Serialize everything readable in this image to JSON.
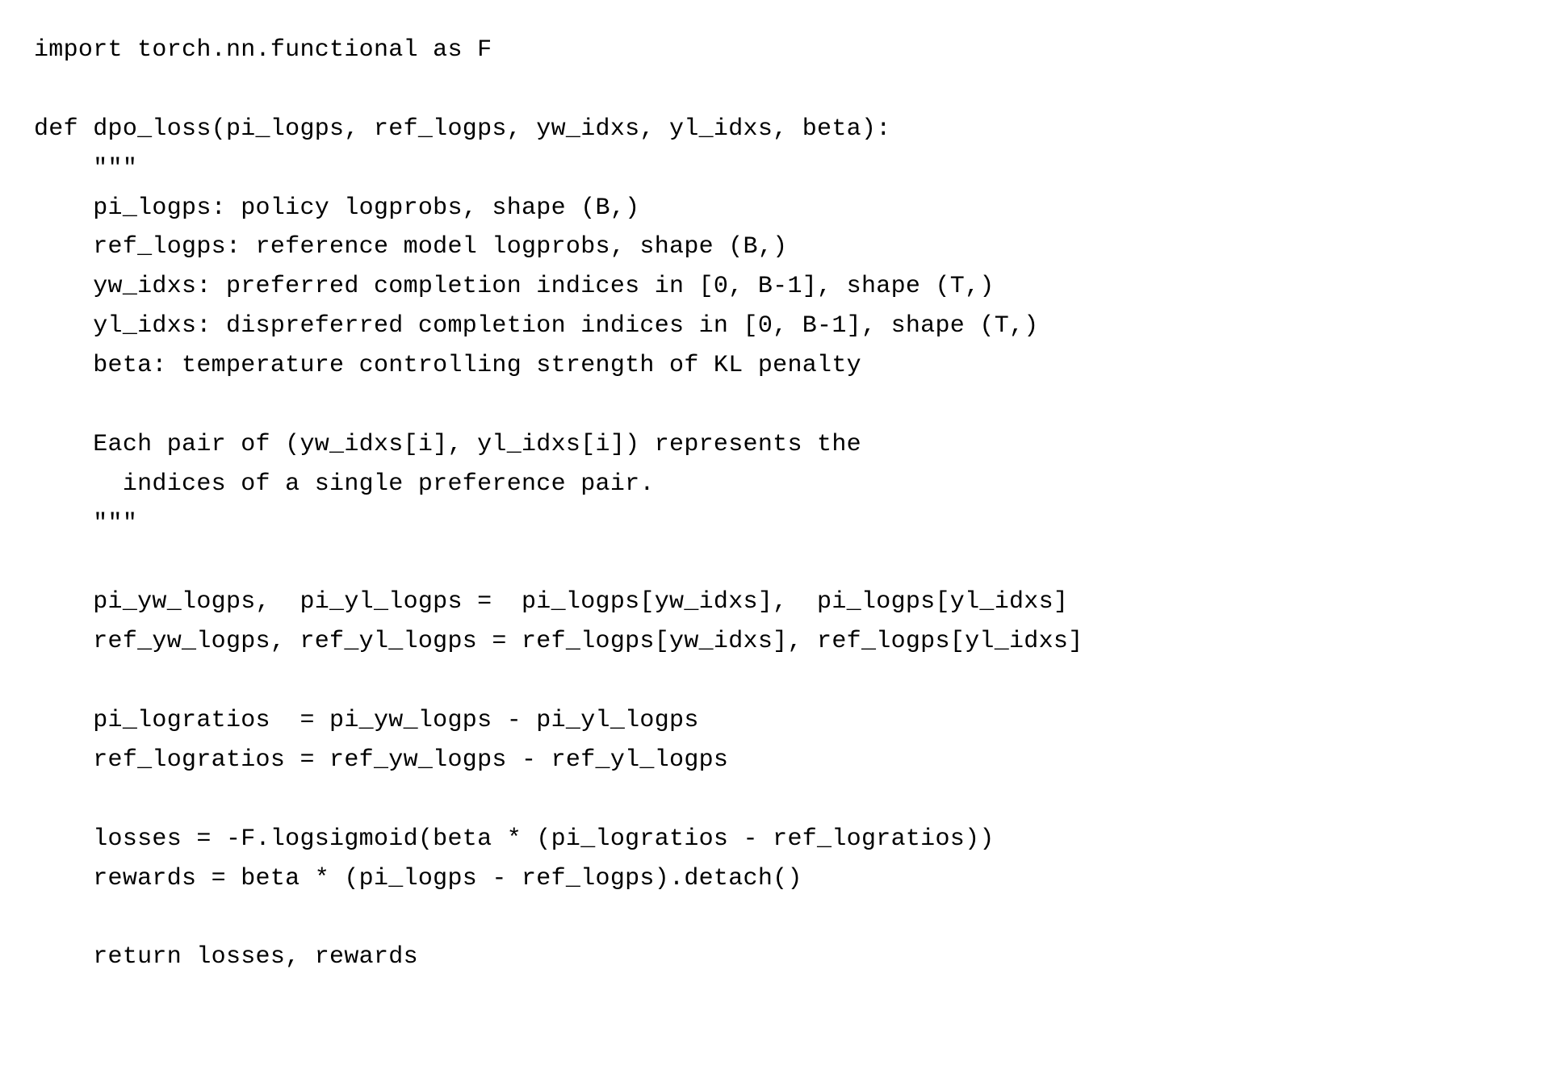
{
  "code": {
    "lines": [
      "import torch.nn.functional as F",
      "",
      "def dpo_loss(pi_logps, ref_logps, yw_idxs, yl_idxs, beta):",
      "    \"\"\"",
      "    pi_logps: policy logprobs, shape (B,)",
      "    ref_logps: reference model logprobs, shape (B,)",
      "    yw_idxs: preferred completion indices in [0, B-1], shape (T,)",
      "    yl_idxs: dispreferred completion indices in [0, B-1], shape (T,)",
      "    beta: temperature controlling strength of KL penalty",
      "",
      "    Each pair of (yw_idxs[i], yl_idxs[i]) represents the",
      "      indices of a single preference pair.",
      "    \"\"\"",
      "",
      "    pi_yw_logps,  pi_yl_logps =  pi_logps[yw_idxs],  pi_logps[yl_idxs]",
      "    ref_yw_logps, ref_yl_logps = ref_logps[yw_idxs], ref_logps[yl_idxs]",
      "",
      "    pi_logratios  = pi_yw_logps - pi_yl_logps",
      "    ref_logratios = ref_yw_logps - ref_yl_logps",
      "",
      "    losses = -F.logsigmoid(beta * (pi_logratios - ref_logratios))",
      "    rewards = beta * (pi_logps - ref_logps).detach()",
      "",
      "    return losses, rewards"
    ]
  }
}
